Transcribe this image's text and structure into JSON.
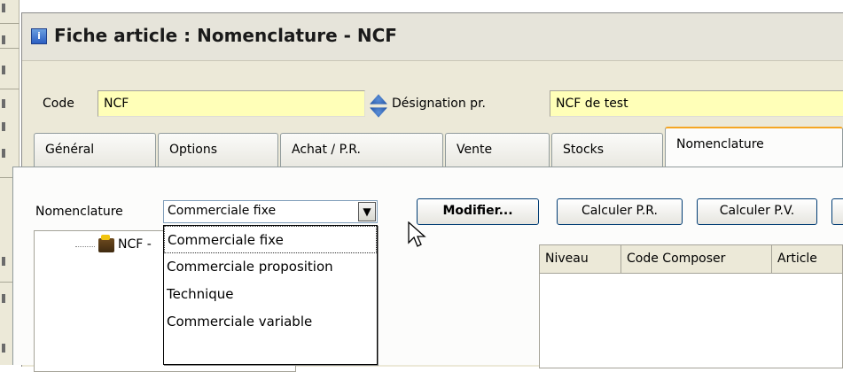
{
  "window": {
    "title": "Fiche article : Nomenclature - NCF",
    "icon": "app-icon"
  },
  "header": {
    "code_label": "Code",
    "code_value": "NCF",
    "designation_label": "Désignation pr.",
    "designation_value": "NCF de test"
  },
  "tabs": [
    {
      "label": "Général"
    },
    {
      "label": "Options"
    },
    {
      "label": "Achat / P.R."
    },
    {
      "label": "Vente"
    },
    {
      "label": "Stocks"
    },
    {
      "label": "Nomenclature",
      "active": true
    }
  ],
  "toolbar": {
    "nomenclature_label": "Nomenclature",
    "nomenclature_value": "Commerciale fixe",
    "modifier_label": "Modifier...",
    "calc_pr_label": "Calculer P.R.",
    "calc_pv_label": "Calculer P.V."
  },
  "dropdown": {
    "options": [
      "Commerciale fixe",
      "Commerciale proposition",
      "Technique",
      "Commerciale variable"
    ],
    "selected": "Commerciale fixe"
  },
  "tree": {
    "root_label": "NCF -"
  },
  "grid": {
    "columns": [
      "Niveau",
      "Code Composer",
      "Article"
    ]
  },
  "colors": {
    "field_yellow": "#ffffb8",
    "active_tab_accent": "#f5a623",
    "button_border": "#003c74"
  }
}
